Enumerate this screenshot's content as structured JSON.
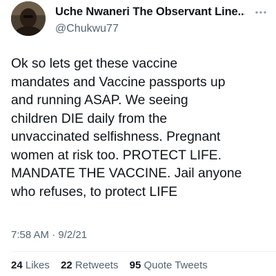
{
  "author": {
    "display_name": "Uche Nwaneri The Observant Line...",
    "handle": "@Chukwu77",
    "verified_color": "#1d9bf0",
    "avatar_icon": "avatar"
  },
  "tweet": {
    "lines": [
      "Ok so lets get these vaccine",
      "mandates and Vaccine passports up",
      "and running ASAP. We seeing",
      "children DIE daily from the",
      "unvaccinated selfishness. Pregnant",
      "women at risk too. PROTECT LIFE.",
      "MANDATE THE VACCINE. Jail anyone",
      "who refuses, to protect LIFE"
    ],
    "time": "7:58 AM",
    "separator": "·",
    "date": "9/2/21"
  },
  "stats": {
    "likes_count": "24",
    "likes_label": "Likes",
    "retweets_count": "22",
    "retweets_label": "Retweets",
    "quote_count": "95",
    "quote_label": "Quote Tweets"
  },
  "colors": {
    "text_primary": "#0f1419",
    "text_secondary": "#536471",
    "divider": "#eff3f4"
  }
}
